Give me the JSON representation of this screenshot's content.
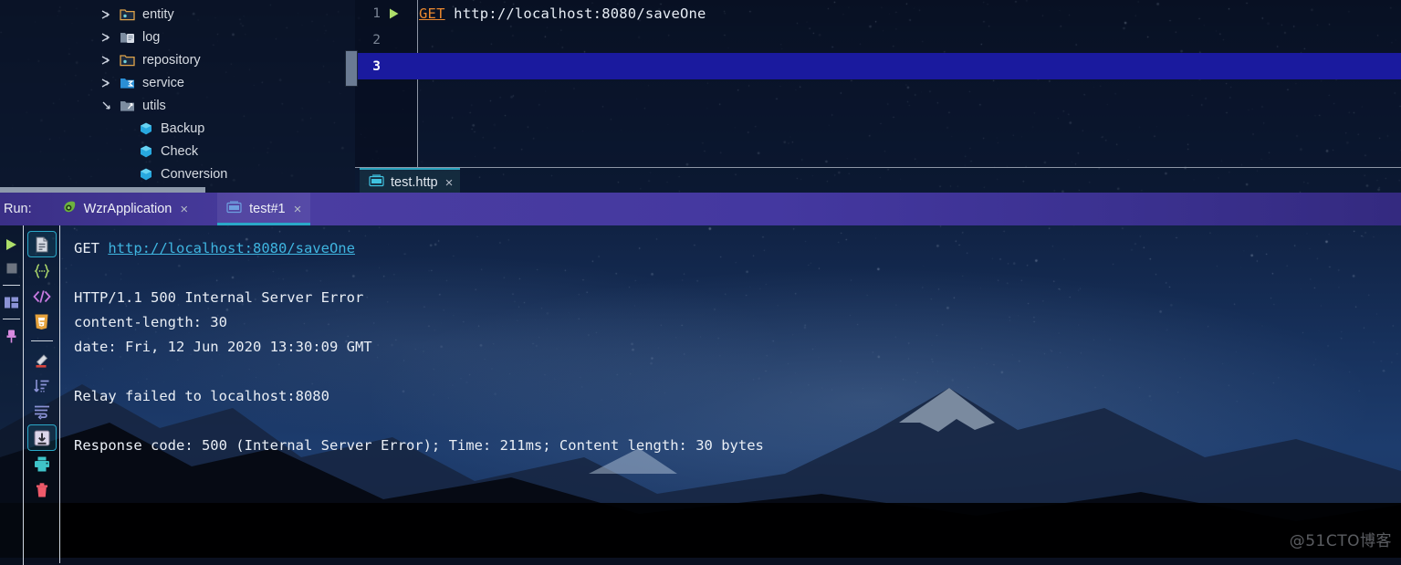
{
  "project_tree": {
    "items": [
      {
        "label": "entity",
        "icon": "folder-package-orange-icon",
        "arrow": "chevron-right-icon",
        "indent": 0
      },
      {
        "label": "log",
        "icon": "folder-resource-gray-icon",
        "arrow": "chevron-right-icon",
        "indent": 0
      },
      {
        "label": "repository",
        "icon": "folder-package-orange-icon",
        "arrow": "chevron-right-icon",
        "indent": 0
      },
      {
        "label": "service",
        "icon": "folder-source-blue-icon",
        "arrow": "chevron-right-icon",
        "indent": 0
      },
      {
        "label": "utils",
        "icon": "folder-test-gray-icon",
        "arrow": "chevron-down-icon",
        "indent": 0
      },
      {
        "label": "Backup",
        "icon": "java-class-icon",
        "arrow": "none",
        "indent": 1
      },
      {
        "label": "Check",
        "icon": "java-class-icon",
        "arrow": "none",
        "indent": 1
      },
      {
        "label": "Conversion",
        "icon": "java-class-icon",
        "arrow": "none",
        "indent": 1
      }
    ]
  },
  "editor": {
    "lines": [
      {
        "number": "1",
        "gutter_icon": "run-request-green-triangle-icon",
        "method": "GET",
        "url": "http://localhost:8080/saveOne"
      },
      {
        "number": "2",
        "gutter_icon": "none",
        "method": "",
        "url": ""
      },
      {
        "number": "3",
        "gutter_icon": "none",
        "method": "",
        "url": ""
      }
    ],
    "active_line": "3",
    "tab": {
      "label": "test.http",
      "icon": "http-api-file-icon",
      "close": "×"
    }
  },
  "run_panel": {
    "label": "Run:",
    "tabs": [
      {
        "label": "WzrApplication",
        "icon": "spring-boot-leaf-icon",
        "close": "×",
        "active": false
      },
      {
        "label": "test#1",
        "icon": "http-api-file-icon",
        "close": "×",
        "active": true
      }
    ],
    "gutter_buttons": [
      {
        "name": "rerun-button",
        "icon": "play-green-triangle-icon"
      },
      {
        "name": "stop-button",
        "icon": "stop-gray-square-icon"
      },
      {
        "name": "layout-button",
        "icon": "layout-panels-icon"
      },
      {
        "name": "pin-tab-button",
        "icon": "pin-pink-icon"
      }
    ],
    "console_tools": [
      {
        "name": "view-as-text-button",
        "icon": "document-text-icon",
        "selected": true
      },
      {
        "name": "view-as-json-button",
        "icon": "json-braces-icon",
        "selected": false
      },
      {
        "name": "view-as-xml-button",
        "icon": "xml-angle-brackets-icon",
        "selected": false
      },
      {
        "name": "view-as-html-button",
        "icon": "html5-badge-icon",
        "selected": false
      },
      {
        "name": "highlight-button",
        "icon": "marker-pen-icon",
        "selected": false
      },
      {
        "name": "sort-button",
        "icon": "sort-lines-icon",
        "selected": false
      },
      {
        "name": "soft-wrap-button",
        "icon": "soft-wrap-icon",
        "selected": false
      },
      {
        "name": "scroll-to-end-button",
        "icon": "scroll-to-end-icon",
        "selected": true
      },
      {
        "name": "print-button",
        "icon": "printer-icon",
        "selected": false
      },
      {
        "name": "clear-console-button",
        "icon": "trash-icon",
        "selected": false
      }
    ],
    "console": {
      "request_method": "GET",
      "request_url": "http://localhost:8080/saveOne",
      "status_line": "HTTP/1.1 500 Internal Server Error",
      "header_content_length": "content-length: 30",
      "header_date": "date: Fri, 12 Jun 2020 13:30:09 GMT",
      "body": "Relay failed to localhost:8080",
      "summary": "Response code: 500 (Internal Server Error); Time: 211ms; Content length: 30 bytes"
    }
  },
  "watermark": "@51CTO博客",
  "colors": {
    "accent_cyan": "#2aa8c8",
    "link": "#3fb5e0",
    "method_orange": "#e8872f",
    "active_line": "#1a1a9e",
    "run_header": "#4438a0"
  }
}
